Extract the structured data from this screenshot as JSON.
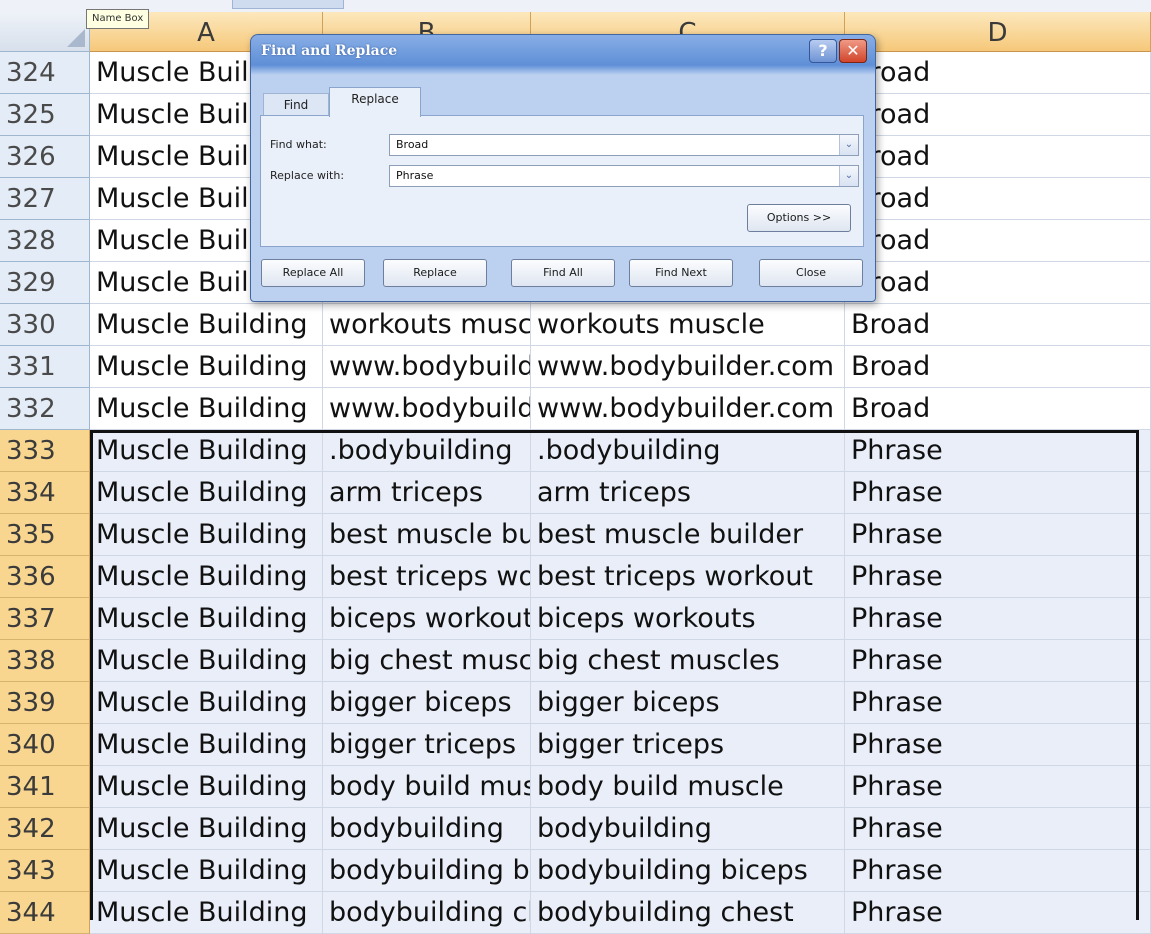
{
  "name_box_tooltip": "Name Box",
  "columns": [
    "A",
    "B",
    "C",
    "D"
  ],
  "rows": [
    {
      "num": "324",
      "a": "Muscle Building",
      "b": "",
      "c": "",
      "d": "Broad"
    },
    {
      "num": "325",
      "a": "Muscle Building",
      "b": "",
      "c": "",
      "d": "Broad"
    },
    {
      "num": "326",
      "a": "Muscle Building",
      "b": "",
      "c": "",
      "d": "Broad"
    },
    {
      "num": "327",
      "a": "Muscle Building",
      "b": "",
      "c": "",
      "d": "Broad"
    },
    {
      "num": "328",
      "a": "Muscle Building",
      "b": "",
      "c": "",
      "d": "Broad"
    },
    {
      "num": "329",
      "a": "Muscle Building",
      "b": "",
      "c": "",
      "d": "Broad"
    },
    {
      "num": "330",
      "a": "Muscle Building",
      "b": "workouts muscle",
      "c": "workouts muscle",
      "d": "Broad"
    },
    {
      "num": "331",
      "a": "Muscle Building",
      "b": "www.bodybuilder.com",
      "c": "www.bodybuilder.com",
      "d": "Broad"
    },
    {
      "num": "332",
      "a": "Muscle Building",
      "b": "www.bodybuilder.com",
      "c": "www.bodybuilder.com",
      "d": "Broad"
    },
    {
      "num": "333",
      "a": "Muscle Building",
      "b": ".bodybuilding",
      "c": ".bodybuilding",
      "d": "Phrase"
    },
    {
      "num": "334",
      "a": "Muscle Building",
      "b": "arm triceps",
      "c": "arm triceps",
      "d": "Phrase"
    },
    {
      "num": "335",
      "a": "Muscle Building",
      "b": "best muscle builder",
      "c": "best muscle builder",
      "d": "Phrase"
    },
    {
      "num": "336",
      "a": "Muscle Building",
      "b": "best triceps workout",
      "c": "best triceps workout",
      "d": "Phrase"
    },
    {
      "num": "337",
      "a": "Muscle Building",
      "b": "biceps workouts",
      "c": "biceps workouts",
      "d": "Phrase"
    },
    {
      "num": "338",
      "a": "Muscle Building",
      "b": "big chest muscles",
      "c": "big chest muscles",
      "d": "Phrase"
    },
    {
      "num": "339",
      "a": "Muscle Building",
      "b": "bigger biceps",
      "c": "bigger biceps",
      "d": "Phrase"
    },
    {
      "num": "340",
      "a": "Muscle Building",
      "b": "bigger triceps",
      "c": "bigger triceps",
      "d": "Phrase"
    },
    {
      "num": "341",
      "a": "Muscle Building",
      "b": "body build muscle",
      "c": "body build muscle",
      "d": "Phrase"
    },
    {
      "num": "342",
      "a": "Muscle Building",
      "b": "bodybuilding",
      "c": "bodybuilding",
      "d": "Phrase"
    },
    {
      "num": "343",
      "a": "Muscle Building",
      "b": "bodybuilding biceps",
      "c": "bodybuilding biceps",
      "d": "Phrase"
    },
    {
      "num": "344",
      "a": "Muscle Building",
      "b": "bodybuilding chest",
      "c": "bodybuilding chest",
      "d": "Phrase"
    }
  ],
  "dialog": {
    "title": "Find and Replace",
    "help_label": "?",
    "close_label": "✕",
    "tab_find": "Find",
    "tab_replace": "Replace",
    "find_what_label": "Find what:",
    "find_what_value": "Broad",
    "replace_with_label": "Replace with:",
    "replace_with_value": "Phrase",
    "dropdown_glyph": "⌄",
    "options_button": "Options >>",
    "replace_all_button": "Replace All",
    "replace_button": "Replace",
    "find_all_button": "Find All",
    "find_next_button": "Find Next",
    "close_button": "Close"
  }
}
